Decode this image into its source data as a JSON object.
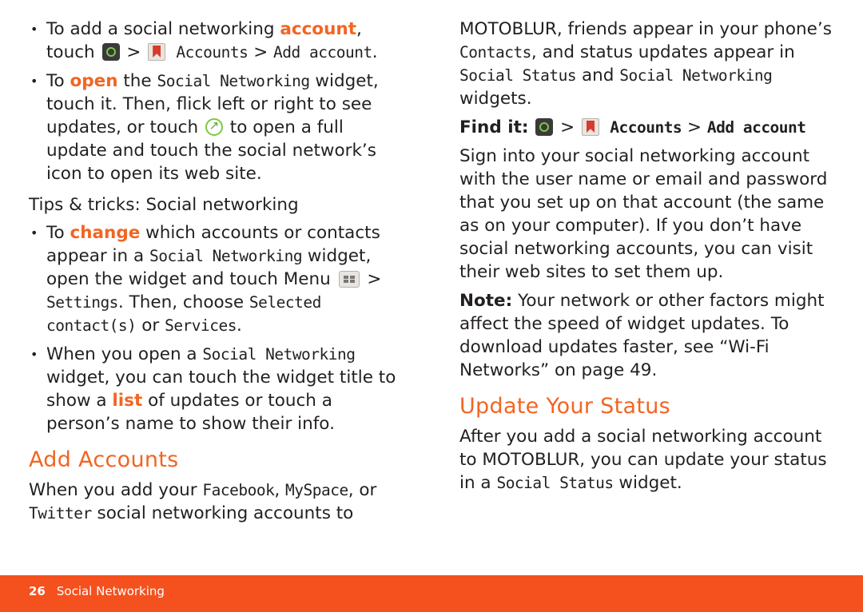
{
  "page": {
    "number": "26",
    "section_title": "Social Networking",
    "footer_color": "#f4511e",
    "heading_color": "#f26522",
    "body_color": "#231f20"
  },
  "left_column": {
    "bullets": [
      {
        "id": "add-account",
        "segments": [
          {
            "text": "To add a social networking ",
            "style": "normal"
          },
          {
            "text": "account",
            "style": "orange"
          },
          {
            "text": ", touch ",
            "style": "normal"
          },
          {
            "text": "motoblur-icon",
            "style": "icon"
          },
          {
            "text": " > ",
            "style": "normal"
          },
          {
            "text": "accounts-icon",
            "style": "icon"
          },
          {
            "text": " Accounts",
            "style": "ui"
          },
          {
            "text": " > ",
            "style": "normal"
          },
          {
            "text": "Add account",
            "style": "ui"
          },
          {
            "text": ".",
            "style": "normal"
          }
        ]
      },
      {
        "id": "open-widget",
        "segments": [
          {
            "text": "To ",
            "style": "normal"
          },
          {
            "text": "open",
            "style": "orange"
          },
          {
            "text": " the ",
            "style": "normal"
          },
          {
            "text": "Social Networking",
            "style": "ui"
          },
          {
            "text": " widget, touch it. Then, flick left or right to see updates, or touch ",
            "style": "normal"
          },
          {
            "text": "open-arrow-icon",
            "style": "icon"
          },
          {
            "text": " to open a full update and touch the social network’s icon to open its web site.",
            "style": "normal"
          }
        ]
      }
    ],
    "tips_line": "Tips & tricks: Social networking",
    "tips_bullets": [
      {
        "id": "change-accounts",
        "segments": [
          {
            "text": "To ",
            "style": "normal"
          },
          {
            "text": "change",
            "style": "orange"
          },
          {
            "text": " which accounts or contacts appear in a ",
            "style": "normal"
          },
          {
            "text": "Social Networking",
            "style": "ui"
          },
          {
            "text": " widget, open the widget and touch Menu ",
            "style": "normal"
          },
          {
            "text": "menu-icon",
            "style": "icon"
          },
          {
            "text": " > ",
            "style": "normal"
          },
          {
            "text": "Settings",
            "style": "ui"
          },
          {
            "text": ". Then, choose ",
            "style": "normal"
          },
          {
            "text": "Selected contact(s)",
            "style": "ui"
          },
          {
            "text": " or ",
            "style": "normal"
          },
          {
            "text": "Services",
            "style": "ui"
          },
          {
            "text": ".",
            "style": "normal"
          }
        ]
      },
      {
        "id": "open-social-networking",
        "segments": [
          {
            "text": "When you open a ",
            "style": "normal"
          },
          {
            "text": "Social Networking",
            "style": "ui"
          },
          {
            "text": " widget, you can touch the widget title to show a ",
            "style": "normal"
          },
          {
            "text": "list",
            "style": "orange"
          },
          {
            "text": " of updates or touch a person’s name to show their info.",
            "style": "normal"
          }
        ]
      }
    ],
    "heading": "Add Accounts",
    "after_heading": [
      {
        "id": "add-accounts-intro",
        "segments": [
          {
            "text": "When you add your ",
            "style": "normal"
          },
          {
            "text": "Facebook",
            "style": "ui"
          },
          {
            "text": ", ",
            "style": "normal"
          },
          {
            "text": "MySpace",
            "style": "ui"
          },
          {
            "text": ", or ",
            "style": "normal"
          },
          {
            "text": "Twitter",
            "style": "ui"
          },
          {
            "text": " social networking accounts to",
            "style": "normal"
          }
        ]
      }
    ]
  },
  "right_column": {
    "paragraphs": [
      {
        "id": "motoblur-intro",
        "segments": [
          {
            "text": "MOTOBLUR, friends appear in your phone’s ",
            "style": "normal"
          },
          {
            "text": "Contacts",
            "style": "ui"
          },
          {
            "text": ", and status updates appear in ",
            "style": "normal"
          },
          {
            "text": "Social Status",
            "style": "ui"
          },
          {
            "text": " and ",
            "style": "normal"
          },
          {
            "text": "Social Networking",
            "style": "ui"
          },
          {
            "text": " widgets.",
            "style": "normal"
          }
        ]
      },
      {
        "id": "find-it",
        "segments": [
          {
            "text": "Find it:",
            "style": "bold"
          },
          {
            "text": " ",
            "style": "normal"
          },
          {
            "text": "motoblur-icon",
            "style": "icon"
          },
          {
            "text": " > ",
            "style": "normal"
          },
          {
            "text": "accounts-icon",
            "style": "icon"
          },
          {
            "text": " Accounts",
            "style": "ui-b"
          },
          {
            "text": " > ",
            "style": "normal"
          },
          {
            "text": "Add account",
            "style": "ui-b"
          }
        ]
      },
      {
        "id": "sign-in",
        "segments": [
          {
            "text": "Sign into your social networking account with the user name or email and password that you set up on that account (the same as on your computer). If you don’t have social networking accounts, you can visit their web sites to set them up.",
            "style": "normal"
          }
        ]
      },
      {
        "id": "note",
        "segments": [
          {
            "text": "Note:",
            "style": "bold"
          },
          {
            "text": " Your network or other factors might affect the speed of widget updates. To download updates faster, see “Wi-Fi Networks” on page 49.",
            "style": "normal"
          }
        ]
      }
    ],
    "heading": "Update Your Status",
    "after_heading": [
      {
        "id": "update-status-body",
        "segments": [
          {
            "text": "After you add a social networking account to MOTOBLUR, you can update your status in a ",
            "style": "normal"
          },
          {
            "text": "Social Status",
            "style": "ui"
          },
          {
            "text": " widget.",
            "style": "normal"
          }
        ]
      }
    ]
  }
}
